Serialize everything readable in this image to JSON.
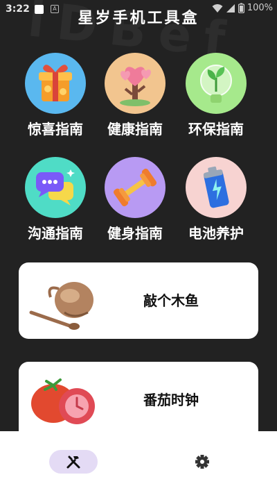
{
  "status_bar": {
    "time": "3:22",
    "battery": "100%"
  },
  "watermark": "iDBef",
  "app_title": "星岁手机工具盒",
  "grid": [
    {
      "label": "惊喜指南",
      "icon": "gift-box-icon",
      "bg": "#5ab8ef"
    },
    {
      "label": "健康指南",
      "icon": "heart-tree-icon",
      "bg": "#f2c58f"
    },
    {
      "label": "环保指南",
      "icon": "leaf-bulb-icon",
      "bg": "#a6e98c"
    },
    {
      "label": "沟通指南",
      "icon": "chat-bubbles-icon",
      "bg": "#4fdcc6"
    },
    {
      "label": "健身指南",
      "icon": "dumbbell-icon",
      "bg": "#b89af3"
    },
    {
      "label": "电池养护",
      "icon": "battery-icon",
      "bg": "#f7d3d1"
    }
  ],
  "cards": [
    {
      "label": "敲个木鱼",
      "icon": "wooden-fish-icon"
    },
    {
      "label": "番茄时钟",
      "icon": "tomato-clock-icon"
    }
  ],
  "nav": {
    "tools_icon": "tools-icon",
    "settings_icon": "gear-icon",
    "active_color": "#e4dbf5"
  }
}
